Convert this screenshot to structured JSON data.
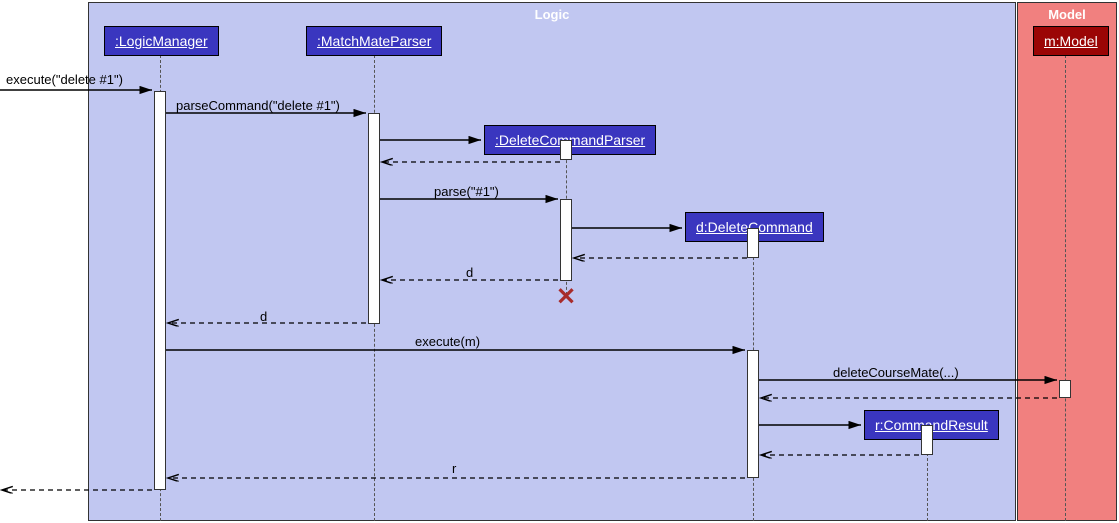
{
  "chart_data": {
    "type": "sequence-diagram",
    "boxes": [
      {
        "name": "Logic",
        "participants": [
          ":LogicManager",
          ":MatchMateParser",
          ":DeleteCommandParser",
          "d:DeleteCommand",
          "r:CommandResult"
        ]
      },
      {
        "name": "Model",
        "participants": [
          "m:Model"
        ]
      }
    ],
    "messages": [
      {
        "from": "external",
        "to": ":LogicManager",
        "label": "execute(\"delete #1\")",
        "type": "sync"
      },
      {
        "from": ":LogicManager",
        "to": ":MatchMateParser",
        "label": "parseCommand(\"delete #1\")",
        "type": "sync"
      },
      {
        "from": ":MatchMateParser",
        "to": ":DeleteCommandParser",
        "label": "",
        "type": "create"
      },
      {
        "from": ":DeleteCommandParser",
        "to": ":MatchMateParser",
        "label": "",
        "type": "return"
      },
      {
        "from": ":MatchMateParser",
        "to": ":DeleteCommandParser",
        "label": "parse(\"#1\")",
        "type": "sync"
      },
      {
        "from": ":DeleteCommandParser",
        "to": "d:DeleteCommand",
        "label": "",
        "type": "create"
      },
      {
        "from": "d:DeleteCommand",
        "to": ":DeleteCommandParser",
        "label": "",
        "type": "return"
      },
      {
        "from": ":DeleteCommandParser",
        "to": ":MatchMateParser",
        "label": "d",
        "type": "return"
      },
      {
        "from": ":DeleteCommandParser",
        "to": null,
        "label": "",
        "type": "destroy"
      },
      {
        "from": ":MatchMateParser",
        "to": ":LogicManager",
        "label": "d",
        "type": "return"
      },
      {
        "from": ":LogicManager",
        "to": "d:DeleteCommand",
        "label": "execute(m)",
        "type": "sync"
      },
      {
        "from": "d:DeleteCommand",
        "to": "m:Model",
        "label": "deleteCourseMate(...)",
        "type": "sync"
      },
      {
        "from": "m:Model",
        "to": "d:DeleteCommand",
        "label": "",
        "type": "return"
      },
      {
        "from": "d:DeleteCommand",
        "to": "r:CommandResult",
        "label": "",
        "type": "create"
      },
      {
        "from": "r:CommandResult",
        "to": "d:DeleteCommand",
        "label": "",
        "type": "return"
      },
      {
        "from": "d:DeleteCommand",
        "to": ":LogicManager",
        "label": "r",
        "type": "return"
      },
      {
        "from": ":LogicManager",
        "to": "external",
        "label": "",
        "type": "return"
      }
    ]
  },
  "boxes": {
    "logic": "Logic",
    "model": "Model"
  },
  "participants": {
    "logicManager": ":LogicManager",
    "matchMateParser": ":MatchMateParser",
    "deleteCommandParser": ":DeleteCommandParser",
    "deleteCommand": "d:DeleteCommand",
    "commandResult": "r:CommandResult",
    "model": "m:Model"
  },
  "messages": {
    "executeDelete": "execute(\"delete #1\")",
    "parseCommand": "parseCommand(\"delete #1\")",
    "parse": "parse(\"#1\")",
    "d1": "d",
    "d2": "d",
    "executeM": "execute(m)",
    "deleteCourseMate": "deleteCourseMate(...)",
    "r": "r"
  }
}
